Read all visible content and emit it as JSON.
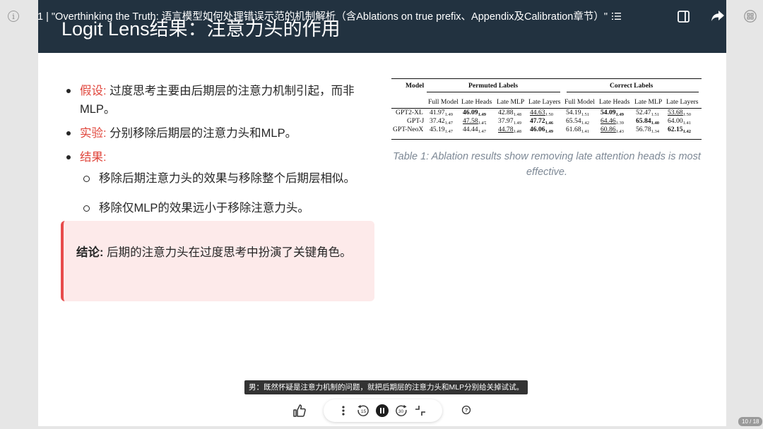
{
  "topbar": {
    "title": "1 | \"Overthinking the Truth: 语言模型如何处理错误示范的机制解析（含Ablations on true prefix、Appendix及Calibration章节）\""
  },
  "slide": {
    "title": "Logit Lens结果：注意力头的作用",
    "bullets": [
      {
        "label": "假设:",
        "text": " 过度思考主要由后期层的注意力机制引起，而非MLP。"
      },
      {
        "label": "实验:",
        "text": " 分别移除后期层的注意力头和MLP。"
      },
      {
        "label": "结果:",
        "text": ""
      }
    ],
    "sub_bullets": [
      "移除后期注意力头的效果与移除整个后期层相似。",
      "移除仅MLP的效果远小于移除注意力头。"
    ],
    "callout": {
      "label": "结论:",
      "text": " 后期的注意力头在过度思考中扮演了关键角色。"
    },
    "table": {
      "model_header": "Model",
      "group_headers": [
        "Permuted Labels",
        "Correct Labels"
      ],
      "col_headers": [
        "Full Model",
        "Late Heads",
        "Late MLP",
        "Late Layers",
        "Full Model",
        "Late Heads",
        "Late MLP",
        "Late Layers"
      ],
      "rows": [
        {
          "model": "GPT2-XL",
          "cells": [
            {
              "v": "41.97",
              "s": "1.49"
            },
            {
              "v": "46.09",
              "s": "1.49",
              "style": "bold"
            },
            {
              "v": "42.88",
              "s": "1.48"
            },
            {
              "v": "44.63",
              "s": "1.50",
              "style": "underline"
            },
            {
              "v": "54.19",
              "s": "1.51"
            },
            {
              "v": "54.09",
              "s": "1.49",
              "style": "bold"
            },
            {
              "v": "52.47",
              "s": "1.51"
            },
            {
              "v": "53.68",
              "s": "1.50",
              "style": "underline"
            }
          ]
        },
        {
          "model": "GPT-J",
          "cells": [
            {
              "v": "37.42",
              "s": "1.47"
            },
            {
              "v": "47.58",
              "s": "1.47",
              "style": "underline"
            },
            {
              "v": "37.97",
              "s": "1.49"
            },
            {
              "v": "47.72",
              "s": "1.46",
              "style": "bold"
            },
            {
              "v": "65.54",
              "s": "1.42"
            },
            {
              "v": "64.46",
              "s": "1.39",
              "style": "underline"
            },
            {
              "v": "65.84",
              "s": "1.40",
              "style": "bold"
            },
            {
              "v": "64.00",
              "s": "1.41"
            }
          ]
        },
        {
          "model": "GPT-NeoX",
          "cells": [
            {
              "v": "45.19",
              "s": "1.47"
            },
            {
              "v": "44.44",
              "s": "1.47"
            },
            {
              "v": "44.78",
              "s": "1.48",
              "style": "underline"
            },
            {
              "v": "46.06",
              "s": "1.49",
              "style": "bold"
            },
            {
              "v": "61.68",
              "s": "1.41"
            },
            {
              "v": "60.86",
              "s": "1.43",
              "style": "underline"
            },
            {
              "v": "56.78",
              "s": "1.34"
            },
            {
              "v": "62.15",
              "s": "1.42",
              "style": "bold"
            }
          ]
        }
      ],
      "caption": "Table 1: Ablation results show removing late attention heads is most effective."
    }
  },
  "player": {
    "subtitle": "男：既然怀疑是注意力机制的问题，就把后期层的注意力头和MLP分别给关掉试试。",
    "rewind_seconds": "15",
    "forward_seconds": "30",
    "page_indicator": "10 / 18"
  },
  "colors": {
    "header_bg": "#223240",
    "accent_red": "#e0453b",
    "callout_bg": "#fdeaea",
    "callout_border": "#e74c4c"
  }
}
